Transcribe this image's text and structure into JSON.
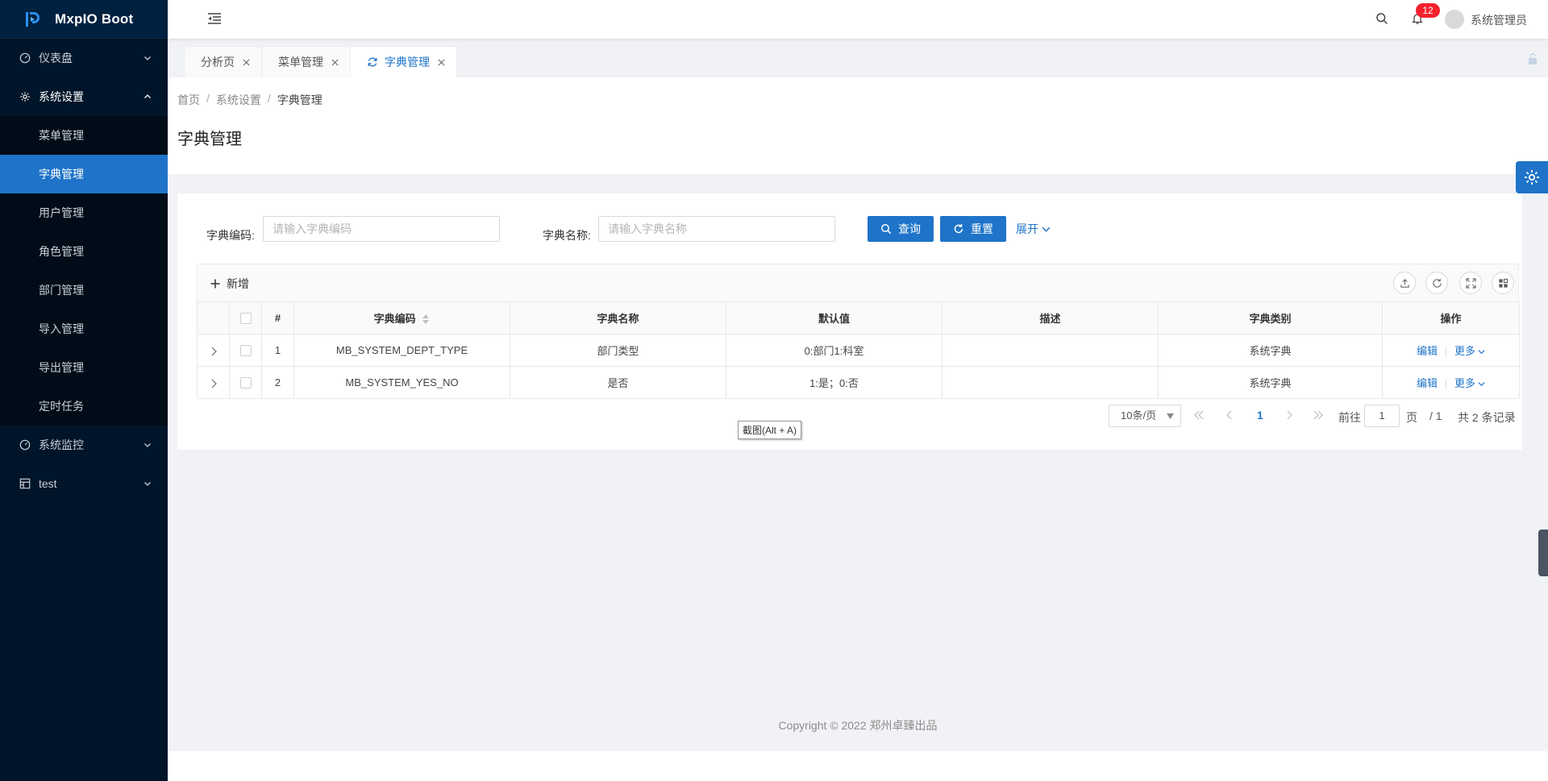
{
  "app": {
    "title": "MxpIO Boot"
  },
  "sidebar": {
    "groups": [
      {
        "label": "仪表盘",
        "icon": "dashboard-icon",
        "open": false
      },
      {
        "label": "系统设置",
        "icon": "gear-icon",
        "open": true,
        "items": [
          "菜单管理",
          "字典管理",
          "用户管理",
          "角色管理",
          "部门管理",
          "导入管理",
          "导出管理",
          "定时任务"
        ],
        "active_item": "字典管理"
      },
      {
        "label": "系统监控",
        "icon": "dashboard-icon",
        "open": false
      },
      {
        "label": "test",
        "icon": "grid-icon",
        "open": false
      }
    ]
  },
  "header": {
    "notification_count": "12",
    "username": "系统管理员"
  },
  "tabs": [
    {
      "label": "分析页",
      "active": false
    },
    {
      "label": "菜单管理",
      "active": false
    },
    {
      "label": "字典管理",
      "active": true
    }
  ],
  "breadcrumb": [
    "首页",
    "系统设置",
    "字典管理"
  ],
  "page": {
    "title": "字典管理"
  },
  "search": {
    "code_label": "字典编码:",
    "code_placeholder": "请输入字典编码",
    "name_label": "字典名称:",
    "name_placeholder": "请输入字典名称",
    "query_label": "查询",
    "reset_label": "重置",
    "expand_label": "展开"
  },
  "toolbar": {
    "add_label": "新增"
  },
  "table": {
    "columns": [
      "#",
      "字典编码",
      "字典名称",
      "默认值",
      "描述",
      "字典类别",
      "操作"
    ],
    "rows": [
      {
        "index": "1",
        "code": "MB_SYSTEM_DEPT_TYPE",
        "name": "部门类型",
        "default": "0:部门1:科室",
        "desc": "",
        "category": "系统字典"
      },
      {
        "index": "2",
        "code": "MB_SYSTEM_YES_NO",
        "name": "是否",
        "default": "1:是；0:否",
        "desc": "",
        "category": "系统字典"
      }
    ],
    "edit_label": "编辑",
    "more_label": "更多"
  },
  "pagination": {
    "page_size": "10条/页",
    "current": "1",
    "goto_prefix": "前往",
    "goto_value": "1",
    "goto_suffix": "页",
    "total_pages": "/ 1",
    "total": "共 2 条记录"
  },
  "tooltip": "截图(Alt + A)",
  "footer": {
    "copyright": "Copyright © 2022 郑州卓臻出品"
  },
  "colors": {
    "primary": "#1f74c9",
    "sidebar": "#001529",
    "badge": "#f5222d"
  }
}
